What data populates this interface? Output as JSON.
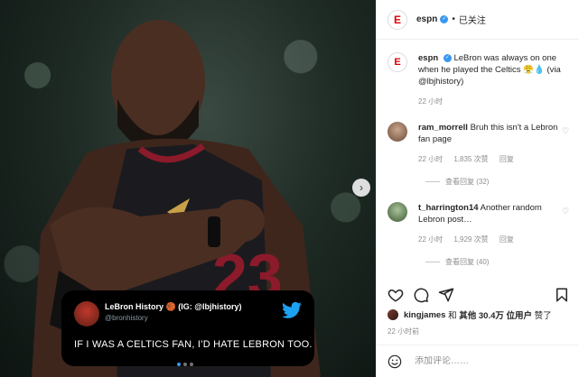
{
  "post": {
    "account": "espn",
    "follow_state": "已关注",
    "separator": "•",
    "logo_letter": "E"
  },
  "media": {
    "tweet": {
      "name": "LeBron History 🏀 (IG: @lbjhistory)",
      "handle": "@bronhistory",
      "text": "IF I WAS A CELTICS FAN, I’D HATE LEBRON TOO."
    },
    "jersey_number": "23",
    "carousel_dots": 3,
    "active_dot": 1
  },
  "caption": {
    "user": "espn",
    "text": "LeBron was always on one when he played the Celtics 😤💧 (via @lbjhistory)",
    "time": "22 小时"
  },
  "comments": [
    {
      "user": "ram_morrell",
      "text": "Bruh this isn't a Lebron fan page",
      "time": "22 小时",
      "likes": "1,835 次赞",
      "reply": "回复",
      "view_replies": "查看回复 (32)",
      "avatar_color": "#8a6a55"
    },
    {
      "user": "t_harrington14",
      "text": "Another random Lebron post…",
      "time": "22 小时",
      "likes": "1,929 次赞",
      "reply": "回复",
      "view_replies": "查看回复 (40)",
      "avatar_color": "#5a7a4a"
    }
  ],
  "likes_line": {
    "user": "kingjames",
    "and": " 和 ",
    "others": "其他 30.4万 位用户",
    "suffix": " 赞了"
  },
  "post_time": "22 小时前",
  "add_comment": {
    "placeholder": "添加评论……"
  },
  "colors": {
    "espn_red": "#d00000",
    "verified_blue": "#3897f0",
    "twitter_blue": "#1da1f2"
  }
}
